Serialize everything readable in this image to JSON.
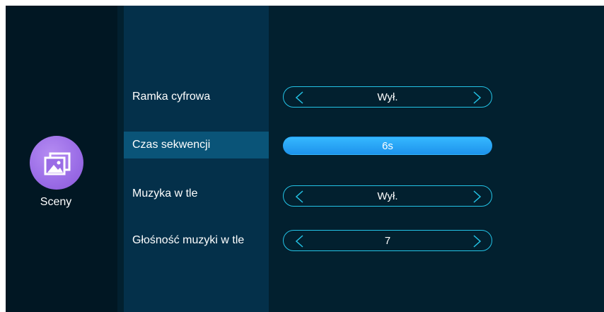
{
  "sidebar": {
    "icon": "gallery-photos-icon",
    "label": "Sceny",
    "icon_color": "#9a6ce6"
  },
  "menu": {
    "items": [
      {
        "label": "Ramka cyfrowa",
        "value": "Wył.",
        "active": false
      },
      {
        "label": "Czas sekwencji",
        "value": "6s",
        "active": true
      },
      {
        "label": "Muzyka w tle",
        "value": "Wył.",
        "active": false
      },
      {
        "label": "Głośność muzyki w tle",
        "value": "7",
        "active": false
      }
    ]
  },
  "colors": {
    "background": "#02202f",
    "sidebar": "#011723",
    "menu_panel": "#04304a",
    "active_item": "#0a5478",
    "accent": "#23c3e6",
    "active_value": "#2aa6f7"
  }
}
